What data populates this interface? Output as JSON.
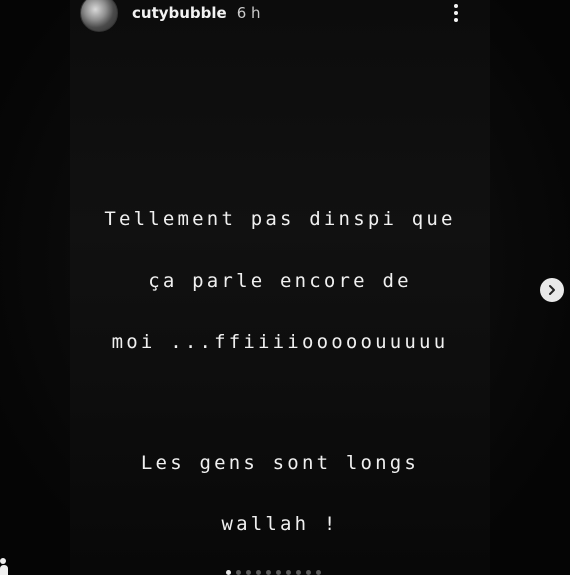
{
  "header": {
    "username": "cutybubble",
    "time": "6 h"
  },
  "story": {
    "lines": [
      "Tellement pas dinspi que",
      "ça parle encore de",
      "moi ...ffiiiiooooouuuuu",
      "Les gens sont longs",
      "wallah !"
    ]
  },
  "controls": {
    "more_icon": "more-vertical-icon",
    "next_icon": "chevron-right-icon",
    "user_icon": "person-icon"
  },
  "progress": {
    "total": 10,
    "current": 1
  },
  "colors": {
    "background": "#050505",
    "text": "#f0f0f0",
    "dot_active": "#e6e6e6",
    "dot_inactive": "#5a5a5a"
  }
}
